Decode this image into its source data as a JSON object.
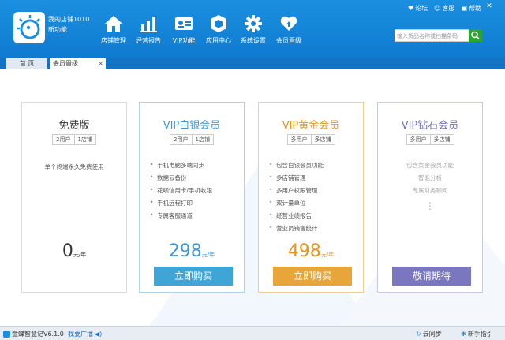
{
  "header": {
    "shop_name": "我的店铺1010",
    "shop_sub": "新功能",
    "nav": [
      {
        "label": "店铺管理",
        "icon": "home-icon"
      },
      {
        "label": "经营报告",
        "icon": "bar-chart-icon"
      },
      {
        "label": "VIP功能",
        "icon": "vip-card-icon"
      },
      {
        "label": "应用中心",
        "icon": "app-box-icon"
      },
      {
        "label": "系统设置",
        "icon": "gear-icon"
      },
      {
        "label": "会员晋级",
        "icon": "heart-upgrade-icon"
      }
    ],
    "top_links": [
      {
        "label": "论坛",
        "icon": "forum-icon"
      },
      {
        "label": "客服",
        "icon": "service-icon"
      },
      {
        "label": "帮助",
        "icon": "help-icon"
      }
    ],
    "search_placeholder": "输入货品名称或扫描条码"
  },
  "tabs": [
    {
      "label": "首 页"
    },
    {
      "label": "会员晋级",
      "close": "×"
    }
  ],
  "plans": [
    {
      "title": "免费版",
      "tags": [
        "2用户",
        "1店铺"
      ],
      "features": [
        "单个终端永久免费使用"
      ],
      "price": "0",
      "unit": "元/年",
      "title_color": "#333333"
    },
    {
      "title": "VIP白银会员",
      "tags": [
        "2用户",
        "1店铺"
      ],
      "features": [
        "手机电脑多端同步",
        "数据云备份",
        "花呗信用卡/手机收银",
        "手机远程打印",
        "专属客服通道"
      ],
      "price": "298",
      "unit": "元/年",
      "button": "立即购买",
      "title_color": "#3d9ad8",
      "button_color": "#3fa4d6"
    },
    {
      "title": "VIP黄金会员",
      "tags": [
        "多用户",
        "多店铺"
      ],
      "features": [
        "包含白银会员功能",
        "多店铺管理",
        "多用户权限管理",
        "双计量单位",
        "经营业绩报告",
        "营业员销售统计"
      ],
      "price": "498",
      "unit": "元/年",
      "button": "立即购买",
      "title_color": "#e8951a",
      "button_color": "#e8a63a"
    },
    {
      "title": "VIP钻石会员",
      "tags": [
        "多用户",
        "多店铺"
      ],
      "features": [
        "包含黄金会员功能",
        "智能分析",
        "专属财务顾问"
      ],
      "dots": "⋮",
      "button": "敬请期待",
      "title_color": "#7070b8",
      "button_color": "#7b76c0"
    }
  ],
  "footer": {
    "app_name": "金蝶智慧记V6.1.0",
    "broadcast": "我要广播",
    "cloud_sync": "云同步",
    "guide": "新手指引"
  }
}
